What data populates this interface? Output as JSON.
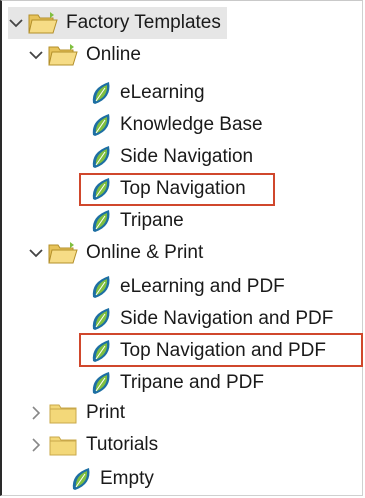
{
  "tree": {
    "root": {
      "label": "Factory Templates",
      "expanded": true,
      "icon": "folder-open-icon"
    },
    "groups": [
      {
        "label": "Online",
        "expanded": true,
        "icon": "folder-open-icon",
        "items": [
          {
            "label": "eLearning",
            "icon": "template-leaf-icon"
          },
          {
            "label": "Knowledge Base",
            "icon": "template-leaf-icon"
          },
          {
            "label": "Side Navigation",
            "icon": "template-leaf-icon"
          },
          {
            "label": "Top Navigation",
            "icon": "template-leaf-icon",
            "highlighted": true
          },
          {
            "label": "Tripane",
            "icon": "template-leaf-icon"
          }
        ]
      },
      {
        "label": "Online & Print",
        "expanded": true,
        "icon": "folder-open-icon",
        "items": [
          {
            "label": "eLearning and PDF",
            "icon": "template-leaf-icon"
          },
          {
            "label": "Side Navigation and PDF",
            "icon": "template-leaf-icon"
          },
          {
            "label": "Top Navigation and PDF",
            "icon": "template-leaf-icon",
            "highlighted": true
          },
          {
            "label": "Tripane and PDF",
            "icon": "template-leaf-icon"
          }
        ]
      },
      {
        "label": "Print",
        "expanded": false,
        "icon": "folder-closed-icon"
      },
      {
        "label": "Tutorials",
        "expanded": false,
        "icon": "folder-closed-icon"
      }
    ],
    "empty": {
      "label": "Empty",
      "icon": "template-leaf-icon"
    }
  },
  "colors": {
    "highlight_border": "#d0472c",
    "root_selection_bg": "#e6e6e6",
    "folder_yellow": "#f3d879",
    "leaf_green": "#7fbf3f",
    "leaf_blue": "#1d6fa3"
  }
}
